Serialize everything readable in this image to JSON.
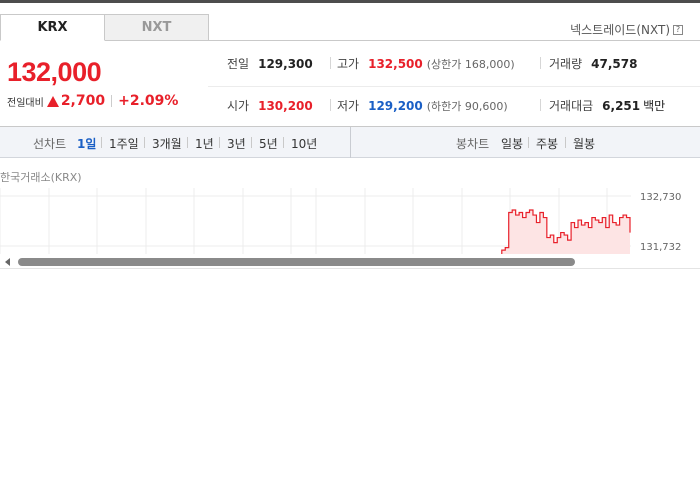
{
  "tabs": [
    {
      "label": "KRX",
      "active": true
    },
    {
      "label": "NXT",
      "active": false
    }
  ],
  "nxt_link": {
    "label": "넥스트레이드(NXT)",
    "help_icon": "?"
  },
  "price": {
    "current": "132,000",
    "change_label": "전일대비",
    "change": "2,700",
    "change_pct": "+2.09%",
    "direction": "up"
  },
  "stats": {
    "prev_close": {
      "label": "전일",
      "value": "129,300"
    },
    "high": {
      "label": "고가",
      "value": "132,500",
      "sub": "(상한가 168,000)"
    },
    "volume": {
      "label": "거래량",
      "value": "47,578"
    },
    "open": {
      "label": "시가",
      "value": "130,200"
    },
    "low": {
      "label": "저가",
      "value": "129,200",
      "sub": "(하한가 90,600)"
    },
    "amount": {
      "label": "거래대금",
      "value": "6,251",
      "unit": "백만"
    }
  },
  "period_bar": {
    "line_title": "선차트",
    "line_items": [
      {
        "label": "1일",
        "active": true
      },
      {
        "label": "1주일",
        "active": false
      },
      {
        "label": "3개월",
        "active": false
      },
      {
        "label": "1년",
        "active": false
      },
      {
        "label": "3년",
        "active": false
      },
      {
        "label": "5년",
        "active": false
      },
      {
        "label": "10년",
        "active": false
      }
    ],
    "candle_title": "봉차트",
    "candle_items": [
      {
        "label": "일봉"
      },
      {
        "label": "주봉"
      },
      {
        "label": "월봉"
      }
    ]
  },
  "chart_data": {
    "type": "area",
    "exchange_label": "한국거래소(KRX)",
    "y_ticks": [
      "132,730",
      "131,732"
    ],
    "ylim": [
      130734,
      132730
    ],
    "series": [
      {
        "values": [
          130900,
          131100,
          131000,
          131450,
          131400,
          131500,
          131650,
          131700,
          132400,
          132450,
          132350,
          132400,
          132300,
          132400,
          132450,
          132350,
          132200,
          132400,
          132300,
          131900,
          131950,
          131800,
          131900,
          132000,
          131950,
          131850,
          132200,
          132100,
          132250,
          132150,
          132200,
          132100,
          132300,
          132250,
          132200,
          132300,
          132100,
          132350,
          132200,
          132150,
          132300,
          132350,
          132300,
          132000
        ],
        "color": "#e8202a"
      }
    ],
    "line_color": "#e8202a",
    "fill_color": "#fde4e4",
    "grid": true
  },
  "scrollbar": {
    "left_arrow_icon": "triangle-left"
  }
}
